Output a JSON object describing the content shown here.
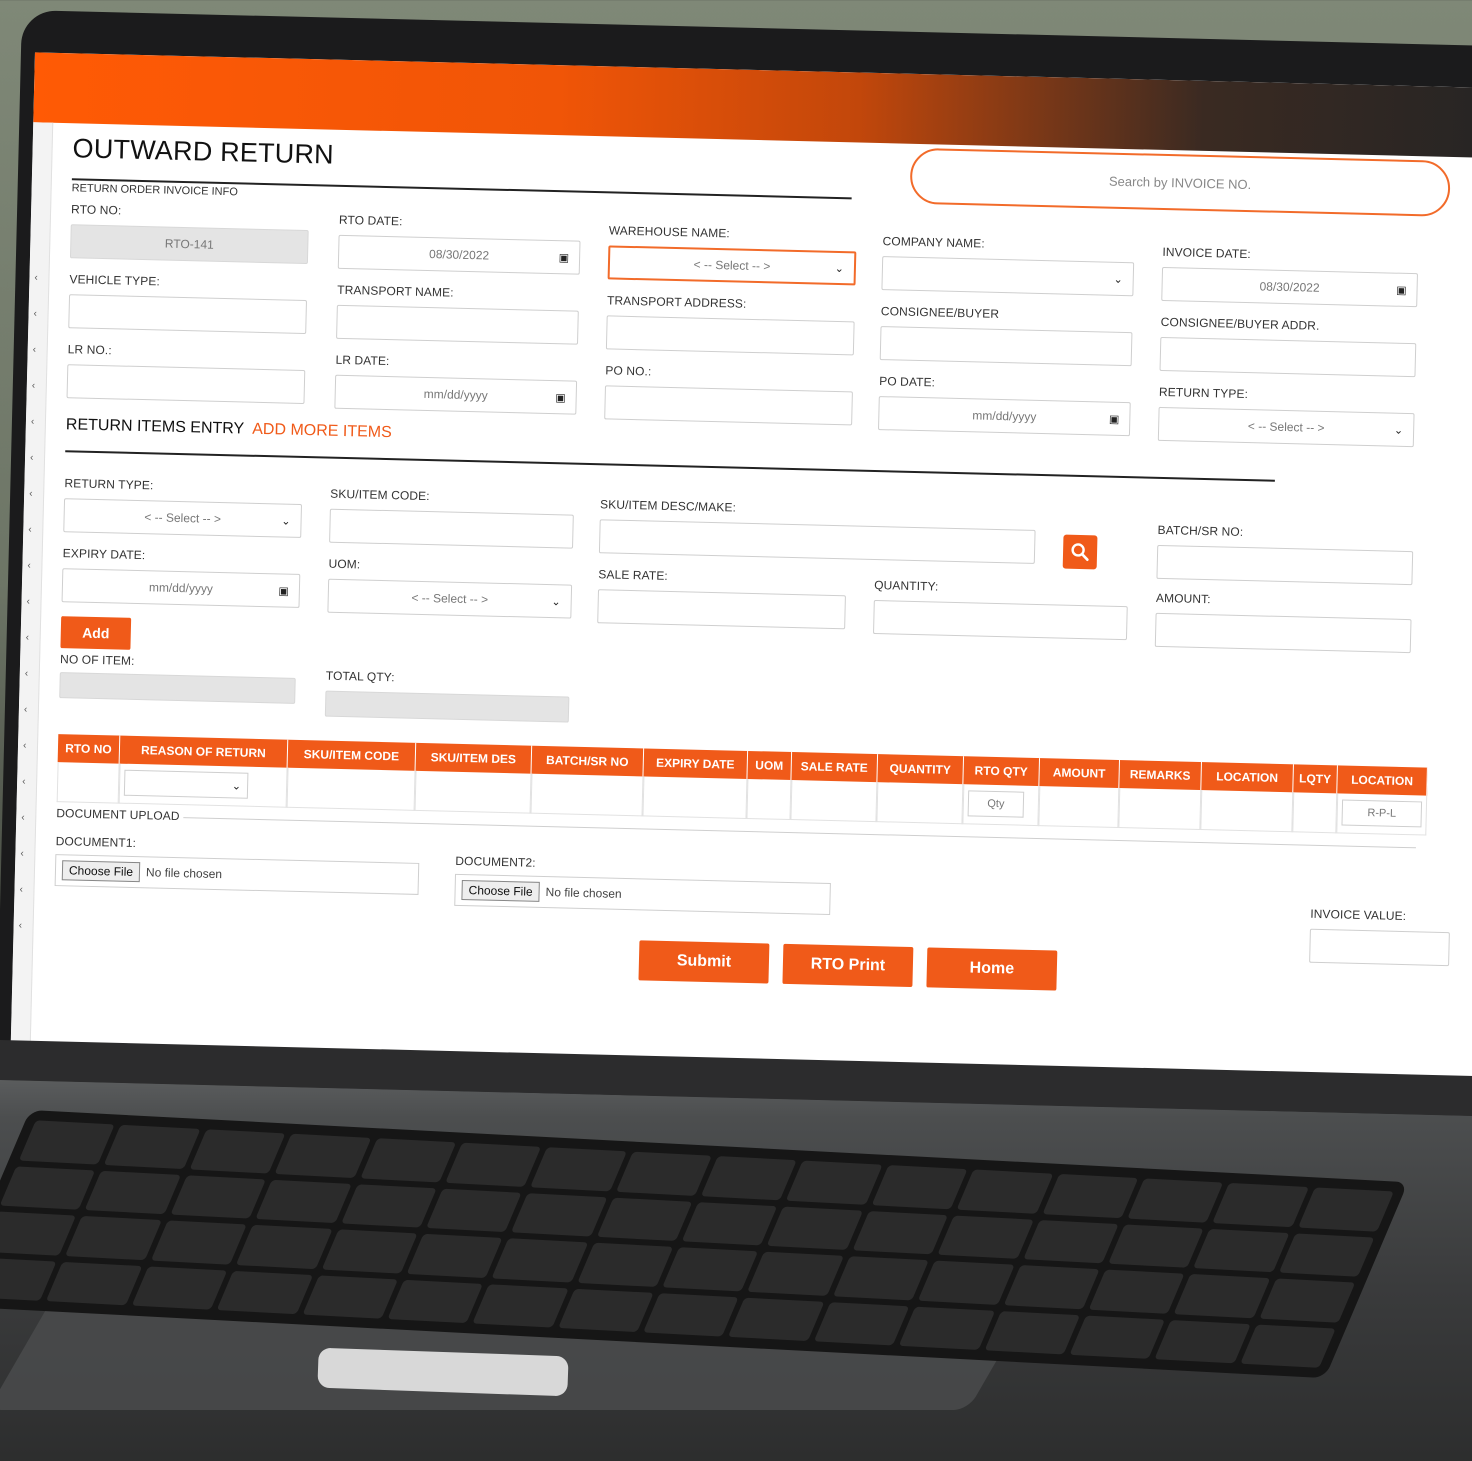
{
  "page": {
    "title": "OUTWARD RETURN",
    "search_placeholder": "Search by INVOICE NO.",
    "section_invoice_info": "RETURN ORDER INVOICE INFO"
  },
  "invoice_info": {
    "rto_no": {
      "label": "RTO NO:",
      "value": "RTO-141"
    },
    "rto_date": {
      "label": "RTO DATE:",
      "value": "08/30/2022"
    },
    "warehouse_name": {
      "label": "WAREHOUSE NAME:",
      "value": "< -- Select -- >"
    },
    "company_name": {
      "label": "COMPANY NAME:",
      "value": ""
    },
    "invoice_date": {
      "label": "INVOICE DATE:",
      "value": "08/30/2022"
    },
    "vehicle_type": {
      "label": "VEHICLE TYPE:"
    },
    "transport_name": {
      "label": "TRANSPORT NAME:"
    },
    "transport_address": {
      "label": "TRANSPORT ADDRESS:"
    },
    "consignee_buyer": {
      "label": "CONSIGNEE/BUYER"
    },
    "consignee_buyer_addr": {
      "label": "CONSIGNEE/BUYER ADDR."
    },
    "lr_no": {
      "label": "LR NO.:"
    },
    "lr_date": {
      "label": "LR DATE:",
      "placeholder": "mm/dd/yyyy"
    },
    "po_no": {
      "label": "PO NO.:"
    },
    "po_date": {
      "label": "PO DATE:",
      "placeholder": "mm/dd/yyyy"
    },
    "return_type": {
      "label": "RETURN TYPE:",
      "value": "< -- Select -- >"
    }
  },
  "items_entry": {
    "heading": "RETURN ITEMS ENTRY",
    "add_more": "ADD MORE ITEMS",
    "return_type": {
      "label": "RETURN TYPE:",
      "value": "< -- Select -- >"
    },
    "sku_code": {
      "label": "SKU/ITEM CODE:"
    },
    "sku_desc": {
      "label": "SKU/ITEM DESC/MAKE:"
    },
    "batch_sr": {
      "label": "BATCH/SR NO:"
    },
    "expiry_date": {
      "label": "EXPIRY DATE:",
      "placeholder": "mm/dd/yyyy"
    },
    "uom": {
      "label": "UOM:",
      "value": "< -- Select -- >"
    },
    "sale_rate": {
      "label": "SALE RATE:"
    },
    "quantity": {
      "label": "QUANTITY:"
    },
    "amount": {
      "label": "AMOUNT:"
    },
    "add_button": "Add",
    "no_of_item": {
      "label": "NO OF ITEM:"
    },
    "total_qty": {
      "label": "TOTAL QTY:"
    }
  },
  "table": {
    "columns": [
      "RTO NO",
      "REASON OF RETURN",
      "SKU/ITEM CODE",
      "SKU/ITEM DES",
      "BATCH/SR NO",
      "EXPIRY DATE",
      "UOM",
      "SALE RATE",
      "QUANTITY",
      "RTO QTY",
      "AMOUNT",
      "REMARKS",
      "LOCATION",
      "LQTY",
      "LOCATION"
    ],
    "row": {
      "rto_qty_placeholder": "Qty",
      "location_value": "R-P-L"
    }
  },
  "documents": {
    "legend": "DOCUMENT UPLOAD",
    "doc1_label": "DOCUMENT1:",
    "doc2_label": "DOCUMENT2:",
    "choose_file": "Choose File",
    "no_file": "No file chosen",
    "invoice_value_label": "INVOICE VALUE:"
  },
  "actions": {
    "submit": "Submit",
    "rto_print": "RTO Print",
    "home": "Home"
  },
  "colors": {
    "accent": "#f05a19",
    "header_dark": "#242424"
  }
}
